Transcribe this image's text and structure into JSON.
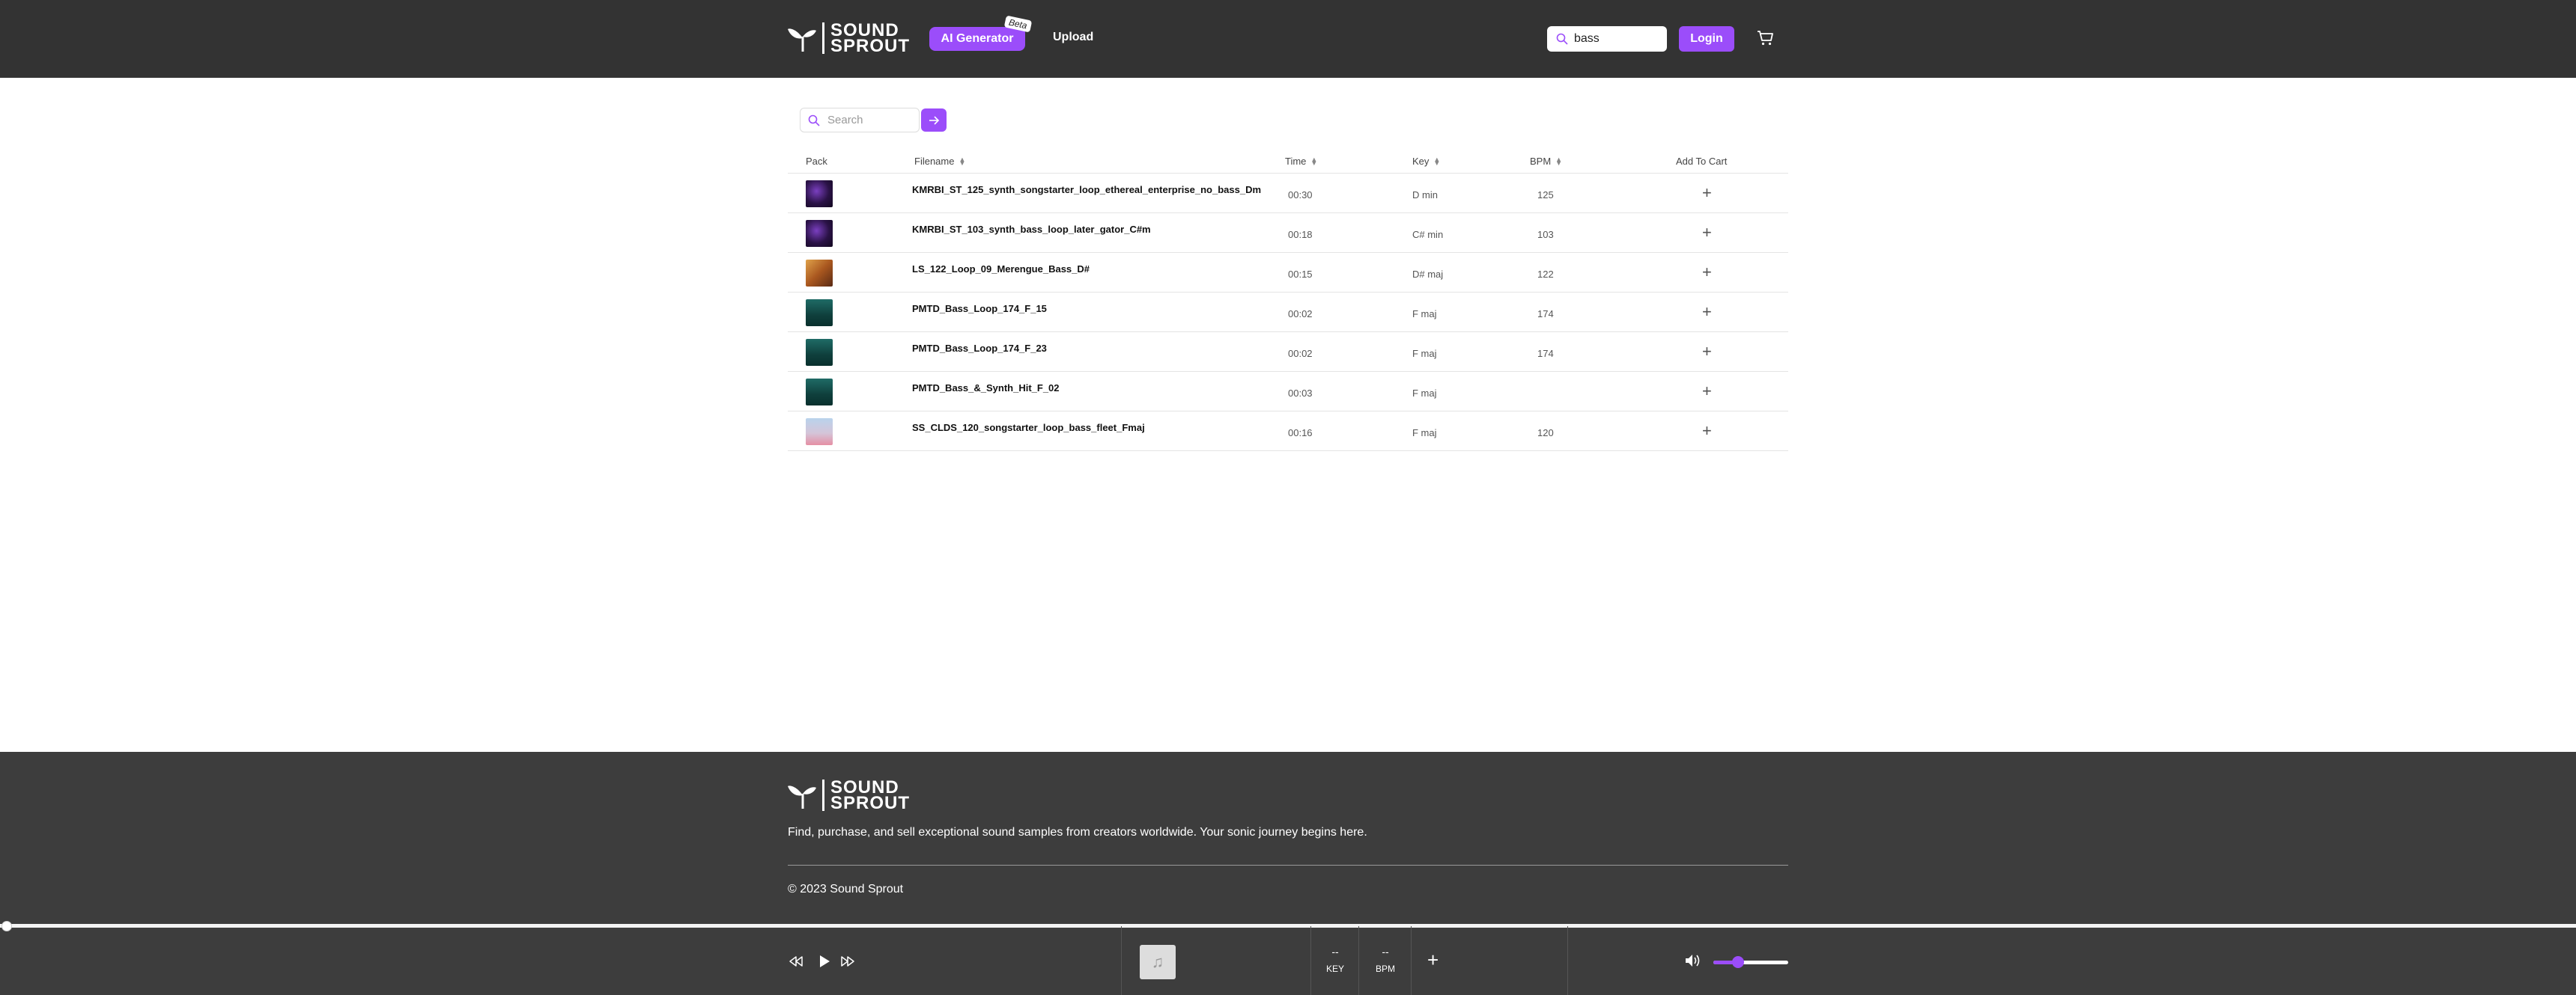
{
  "header": {
    "brand_line1": "SOUND",
    "brand_line2": "SPROUT",
    "ai_generator_label": "AI Generator",
    "beta_badge": "Beta",
    "upload_label": "Upload",
    "search_value": "bass",
    "login_label": "Login"
  },
  "table_search": {
    "placeholder": "Search"
  },
  "table": {
    "columns": [
      "Pack",
      "Filename",
      "Time",
      "Key",
      "BPM",
      "Add To Cart"
    ],
    "rows": [
      {
        "filename": "KMRBI_ST_125_synth_songstarter_loop_ethereal_enterprise_no_bass_Dm",
        "time": "00:30",
        "key": "D min",
        "bpm": "125",
        "thumb": "purple"
      },
      {
        "filename": "KMRBI_ST_103_synth_bass_loop_later_gator_C#m",
        "time": "00:18",
        "key": "C# min",
        "bpm": "103",
        "thumb": "purple"
      },
      {
        "filename": "LS_122_Loop_09_Merengue_Bass_D#",
        "time": "00:15",
        "key": "D# maj",
        "bpm": "122",
        "thumb": "orange"
      },
      {
        "filename": "PMTD_Bass_Loop_174_F_15",
        "time": "00:02",
        "key": "F maj",
        "bpm": "174",
        "thumb": "teal"
      },
      {
        "filename": "PMTD_Bass_Loop_174_F_23",
        "time": "00:02",
        "key": "F maj",
        "bpm": "174",
        "thumb": "teal"
      },
      {
        "filename": "PMTD_Bass_&_Synth_Hit_F_02",
        "time": "00:03",
        "key": "F maj",
        "bpm": "",
        "thumb": "teal"
      },
      {
        "filename": "SS_CLDS_120_songstarter_loop_bass_fleet_Fmaj",
        "time": "00:16",
        "key": "F maj",
        "bpm": "120",
        "thumb": "sky"
      }
    ]
  },
  "footer": {
    "description": "Find, purchase, and sell exceptional sound samples from creators worldwide. Your sonic journey begins here.",
    "copyright": "© 2023 Sound Sprout"
  },
  "player": {
    "key_value": "--",
    "key_label": "KEY",
    "bpm_value": "--",
    "bpm_label": "BPM",
    "volume": 0.33,
    "progress": 0.0
  },
  "colors": {
    "accent": "#9b4dfa",
    "header_bg": "#333333",
    "footer_bg": "#3d3d3d"
  }
}
